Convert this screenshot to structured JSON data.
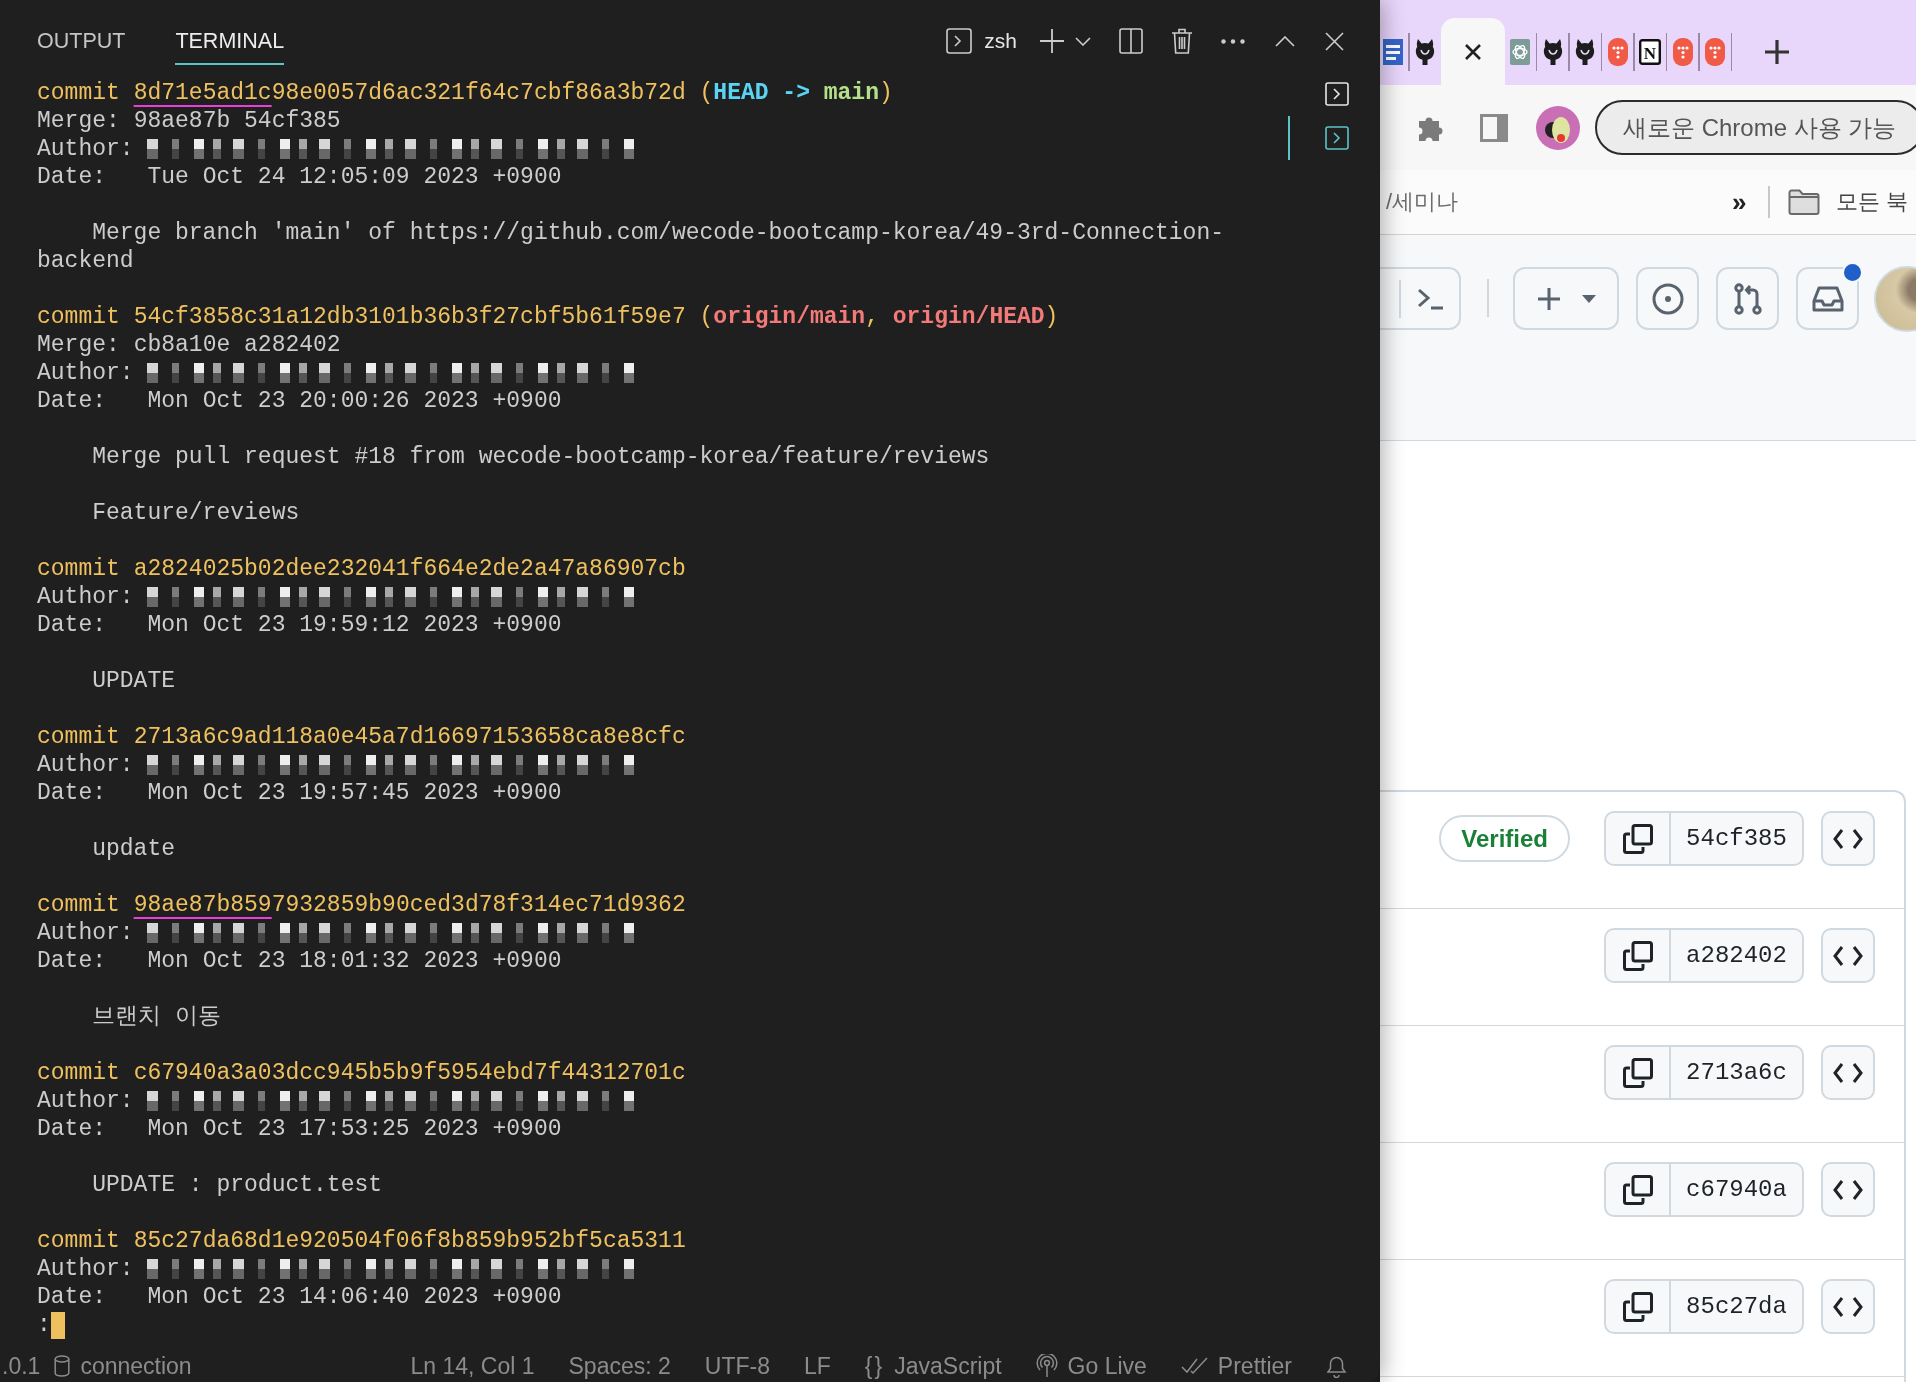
{
  "terminal": {
    "tabs": [
      {
        "label": "OUTPUT",
        "selected": false
      },
      {
        "label": "TERMINAL",
        "selected": true
      }
    ],
    "shell": "zsh",
    "instances": [
      {
        "selected": false
      },
      {
        "selected": true
      }
    ],
    "lines": [
      {
        "kind": "commit",
        "label": "commit",
        "hash": [
          {
            "text": "8d71e5ad1c",
            "underlined": true
          },
          {
            "text": "98e0057d6ac321f64c7cbf86a3b72d",
            "underlined": false
          }
        ],
        "refs": [
          {
            "kind": "punct",
            "text": "(",
            "color": "#efc15e",
            "spaced": false
          },
          {
            "kind": "ref",
            "text": "HEAD",
            "color": "#5ad4f5",
            "spaced": false
          },
          {
            "kind": "ref",
            "text": "->",
            "color": "#5ad4f5",
            "spaced": true
          },
          {
            "kind": "ref",
            "text": "main",
            "color": "#b5e08a",
            "spaced": true
          },
          {
            "kind": "punct",
            "text": ")",
            "color": "#efc15e",
            "spaced": false
          }
        ]
      },
      {
        "kind": "merge",
        "label": "Merge:",
        "value": "98ae87b 54cf385"
      },
      {
        "kind": "author",
        "label": "Author:"
      },
      {
        "kind": "date",
        "label": "Date:",
        "value": "Tue Oct 24 12:05:09 2023 +0900"
      },
      {
        "kind": "blank"
      },
      {
        "kind": "message",
        "text": "Merge branch 'main' of https://github.com/wecode-bootcamp-korea/49-3rd-Connection-"
      },
      {
        "kind": "wrap",
        "text": "backend"
      },
      {
        "kind": "blank"
      },
      {
        "kind": "commit",
        "label": "commit",
        "hash": [
          {
            "text": "54cf3858c31a12db3101b36b3f27cbf5b61f59e7",
            "underlined": false
          }
        ],
        "refs": [
          {
            "kind": "punct",
            "text": "(",
            "color": "#efc15e",
            "spaced": false
          },
          {
            "kind": "ref",
            "text": "origin/main",
            "color": "#f47a7a",
            "spaced": false
          },
          {
            "kind": "punct",
            "text": ",",
            "color": "#efc15e",
            "spaced": false
          },
          {
            "kind": "ref",
            "text": "origin/HEAD",
            "color": "#f47a7a",
            "spaced": true
          },
          {
            "kind": "punct",
            "text": ")",
            "color": "#efc15e",
            "spaced": false
          }
        ]
      },
      {
        "kind": "merge",
        "label": "Merge:",
        "value": "cb8a10e a282402"
      },
      {
        "kind": "author",
        "label": "Author:"
      },
      {
        "kind": "date",
        "label": "Date:",
        "value": "Mon Oct 23 20:00:26 2023 +0900"
      },
      {
        "kind": "blank"
      },
      {
        "kind": "message",
        "text": "Merge pull request #18 from wecode-bootcamp-korea/feature/reviews"
      },
      {
        "kind": "blank"
      },
      {
        "kind": "message",
        "text": "Feature/reviews"
      },
      {
        "kind": "blank"
      },
      {
        "kind": "commit",
        "label": "commit",
        "hash": [
          {
            "text": "a2824025b02dee232041f664e2de2a47a86907cb",
            "underlined": false
          }
        ]
      },
      {
        "kind": "author",
        "label": "Author:"
      },
      {
        "kind": "date",
        "label": "Date:",
        "value": "Mon Oct 23 19:59:12 2023 +0900"
      },
      {
        "kind": "blank"
      },
      {
        "kind": "message",
        "text": "UPDATE"
      },
      {
        "kind": "blank"
      },
      {
        "kind": "commit",
        "label": "commit",
        "hash": [
          {
            "text": "2713a6c9ad118a0e45a7d16697153658ca8e8cfc",
            "underlined": false
          }
        ]
      },
      {
        "kind": "author",
        "label": "Author:"
      },
      {
        "kind": "date",
        "label": "Date:",
        "value": "Mon Oct 23 19:57:45 2023 +0900"
      },
      {
        "kind": "blank"
      },
      {
        "kind": "message",
        "text": "update"
      },
      {
        "kind": "blank"
      },
      {
        "kind": "commit",
        "label": "commit",
        "hash": [
          {
            "text": "98ae87b859",
            "underlined": true
          },
          {
            "text": "7932859b90ced3d78f314ec71d9362",
            "underlined": false
          }
        ]
      },
      {
        "kind": "author",
        "label": "Author:"
      },
      {
        "kind": "date",
        "label": "Date:",
        "value": "Mon Oct 23 18:01:32 2023 +0900"
      },
      {
        "kind": "blank"
      },
      {
        "kind": "message",
        "text": "브랜치 이동"
      },
      {
        "kind": "blank"
      },
      {
        "kind": "commit",
        "label": "commit",
        "hash": [
          {
            "text": "c67940a3a03dcc945b5b9f5954ebd7f44312701c",
            "underlined": false
          }
        ]
      },
      {
        "kind": "author",
        "label": "Author:"
      },
      {
        "kind": "date",
        "label": "Date:",
        "value": "Mon Oct 23 17:53:25 2023 +0900"
      },
      {
        "kind": "blank"
      },
      {
        "kind": "message",
        "text": "UPDATE : product.test"
      },
      {
        "kind": "blank"
      },
      {
        "kind": "commit",
        "label": "commit",
        "hash": [
          {
            "text": "85c27da68d1e920504f06f8b859b952bf5ca5311",
            "underlined": false
          }
        ]
      },
      {
        "kind": "author",
        "label": "Author:"
      },
      {
        "kind": "date",
        "label": "Date:",
        "value": "Mon Oct 23 14:06:40 2023 +0900"
      },
      {
        "kind": "prompt",
        "text": ":",
        "cursor": true
      }
    ],
    "status_bar": {
      "left": [
        {
          "kind": "text",
          "text": ".0.1"
        },
        {
          "kind": "database",
          "text": "connection"
        }
      ],
      "right": [
        {
          "kind": "text",
          "text": "Ln 14, Col 1"
        },
        {
          "kind": "text",
          "text": "Spaces: 2"
        },
        {
          "kind": "text",
          "text": "UTF-8"
        },
        {
          "kind": "text",
          "text": "LF"
        },
        {
          "kind": "language",
          "glyph": "{}",
          "text": "JavaScript"
        },
        {
          "kind": "live",
          "text": "Go Live"
        },
        {
          "kind": "check",
          "text": "Prettier"
        },
        {
          "kind": "bell"
        }
      ]
    }
  },
  "browser": {
    "tabs": [
      {
        "kind": "doc",
        "selected": false
      },
      {
        "kind": "cat",
        "selected": false
      },
      {
        "selected": true
      },
      {
        "kind": "knot",
        "selected": false
      },
      {
        "kind": "cat",
        "selected": false
      },
      {
        "kind": "cat",
        "selected": false
      },
      {
        "kind": "pill",
        "selected": false
      },
      {
        "kind": "letter",
        "glyph": "N",
        "selected": false
      },
      {
        "kind": "pill",
        "selected": false
      },
      {
        "kind": "pill",
        "selected": false
      }
    ],
    "update_button": "새로운 Chrome 사용 가능",
    "bookmarks": {
      "items": [
        "/세미나"
      ],
      "overflow": "»",
      "folder": "모든 북"
    }
  },
  "github": {
    "inbox_unread": true,
    "commits": [
      {
        "badge": "Verified",
        "sha": "54cf385"
      },
      {
        "sha": "a282402"
      },
      {
        "sha": "2713a6c"
      },
      {
        "sha": "c67940a"
      },
      {
        "sha": "85c27da"
      }
    ]
  }
}
